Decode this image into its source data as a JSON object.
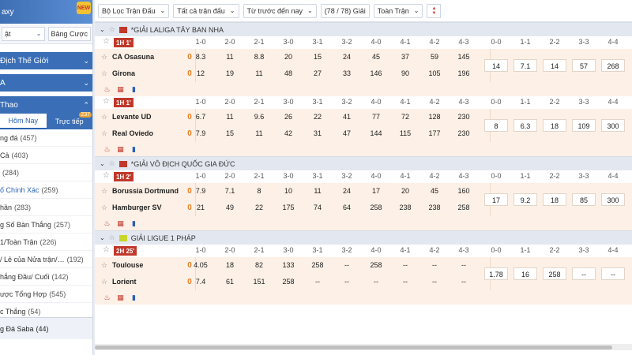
{
  "sidebar": {
    "brand": "axy",
    "badge": "NEW",
    "select1": "ật",
    "select2": "Bảng Cược",
    "section1": "Địch Thế Giới",
    "section2": "A",
    "section3": "Thao",
    "tab_today": "Hôm Nay",
    "tab_live": "Trực tiếp",
    "tab_live_count": "237",
    "items": [
      {
        "label": "ng đá",
        "count": "(457)"
      },
      {
        "label": "Cả",
        "count": "(403)"
      },
      {
        "label": "",
        "count": "(284)"
      },
      {
        "label": "ố Chính Xác",
        "count": "(259)"
      },
      {
        "label": "hần",
        "count": "(283)"
      },
      {
        "label": "g Số Bàn Thắng",
        "count": "(257)"
      },
      {
        "label": "1/Toàn Trận",
        "count": "(226)"
      },
      {
        "label": "/ Lẻ của Nửa trận/…",
        "count": "(192)"
      },
      {
        "label": "hắng Đầu/ Cuối",
        "count": "(142)"
      },
      {
        "label": "ược Tổng Hợp",
        "count": "(545)"
      },
      {
        "label": "c Thắng",
        "count": "(54)"
      }
    ],
    "bottom_label": "g Đá Saba",
    "bottom_count": "(44)"
  },
  "toolbar": {
    "filter_league": "Bộ Lọc Trận Đấu",
    "filter_matches": "Tất cả trận đấu",
    "sort_time": "Từ trước đến nay",
    "count": "(78 / 78) Giải",
    "full_match": "Toàn Trận"
  },
  "score_headers_left": [
    "1-0",
    "2-0",
    "2-1",
    "3-0",
    "3-1",
    "3-2",
    "4-0",
    "4-1",
    "4-2",
    "4-3"
  ],
  "score_headers_right": [
    "0-0",
    "1-1",
    "2-2",
    "3-3",
    "4-4"
  ],
  "leagues": [
    {
      "name": "*GIẢI LALIGA TÂY BAN NHA",
      "flag_color": "#c0392b",
      "matches": [
        {
          "live": "1H 1'",
          "home": "CA Osasuna",
          "home_score": "0",
          "away": "Girona",
          "away_score": "0",
          "home_odds": [
            "8.3",
            "11",
            "8.8",
            "20",
            "15",
            "24",
            "45",
            "37",
            "59",
            "145"
          ],
          "away_odds": [
            "12",
            "19",
            "11",
            "48",
            "27",
            "33",
            "146",
            "90",
            "105",
            "196"
          ],
          "draw_odds": [
            "14",
            "7.1",
            "14",
            "57",
            "268"
          ]
        },
        {
          "live": "1H 1'",
          "home": "Levante UD",
          "home_score": "0",
          "away": "Real Oviedo",
          "away_score": "0",
          "home_odds": [
            "6.7",
            "11",
            "9.6",
            "26",
            "22",
            "41",
            "77",
            "72",
            "128",
            "230"
          ],
          "away_odds": [
            "7.9",
            "15",
            "11",
            "42",
            "31",
            "47",
            "144",
            "115",
            "177",
            "230"
          ],
          "draw_odds": [
            "8",
            "6.3",
            "18",
            "109",
            "300"
          ]
        }
      ]
    },
    {
      "name": "*GIẢI VÔ ĐỊCH QUỐC GIA ĐỨC",
      "flag_color": "#c0392b",
      "matches": [
        {
          "live": "1H 2'",
          "home": "Borussia Dortmund",
          "home_score": "0",
          "away": "Hamburger SV",
          "away_score": "0",
          "home_odds": [
            "7.9",
            "7.1",
            "8",
            "10",
            "11",
            "24",
            "17",
            "20",
            "45",
            "160"
          ],
          "away_odds": [
            "21",
            "49",
            "22",
            "175",
            "74",
            "64",
            "258",
            "238",
            "238",
            "258"
          ],
          "draw_odds": [
            "17",
            "9.2",
            "18",
            "85",
            "300"
          ]
        }
      ]
    },
    {
      "name": "GIẢI LIGUE 1 PHÁP",
      "flag_color": "#c8d62b",
      "matches": [
        {
          "live": "2H 25'",
          "home": "Toulouse",
          "home_score": "0",
          "away": "Lorient",
          "away_score": "0",
          "home_odds": [
            "4.05",
            "18",
            "82",
            "133",
            "258",
            "--",
            "258",
            "--",
            "--",
            "--"
          ],
          "away_odds": [
            "7.4",
            "61",
            "151",
            "258",
            "--",
            "--",
            "--",
            "--",
            "--",
            "--"
          ],
          "draw_odds": [
            "1.78",
            "16",
            "258",
            "--",
            "--"
          ]
        }
      ]
    }
  ]
}
